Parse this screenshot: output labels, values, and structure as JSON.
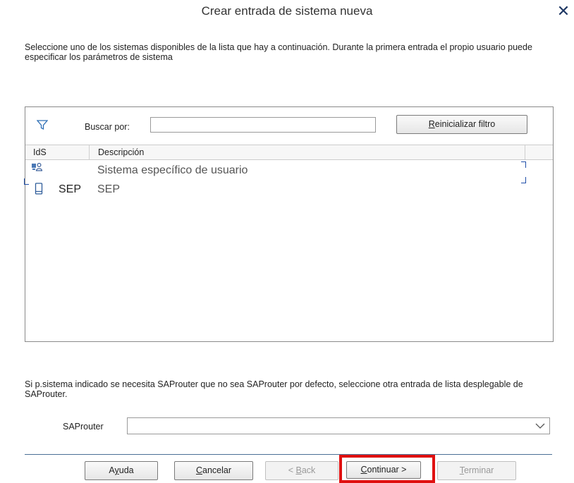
{
  "dialog": {
    "title": "Crear entrada de sistema nueva",
    "close_glyph": "✕",
    "intro_text": "Seleccione uno de los sistemas disponibles de la lista que hay a continuación. Durante la primera entrada el propio usuario puede especificar los parámetros de sistema"
  },
  "filter": {
    "icon": "filter-icon",
    "search_label": "Buscar por:",
    "search_value": "",
    "reset_button": {
      "accel": "R",
      "rest": "einicializar filtro"
    }
  },
  "table": {
    "headers": [
      "IdS",
      "Descripción"
    ],
    "rows": [
      {
        "icon": "user-system-icon",
        "id": "",
        "description": "Sistema específico de usuario"
      },
      {
        "icon": "device-icon",
        "id": "SEP",
        "description": "SEP"
      }
    ]
  },
  "saprouter": {
    "note": "Si p.sistema indicado se necesita SAProuter que no sea SAProuter por defecto, seleccione otra entrada de lista desplegable de SAProuter.",
    "label": "SAProuter",
    "value": ""
  },
  "footer": {
    "help": {
      "pre": "A",
      "accel": "y",
      "post": "uda"
    },
    "cancel": {
      "accel": "C",
      "post": "ancelar"
    },
    "back": {
      "pre": "< ",
      "accel": "B",
      "post": "ack"
    },
    "continue": {
      "accel": "C",
      "post": "ontinuar >"
    },
    "finish": {
      "accel": "T",
      "post": "erminar"
    }
  },
  "colors": {
    "highlight": "#e01010",
    "accent": "#1f3864"
  }
}
